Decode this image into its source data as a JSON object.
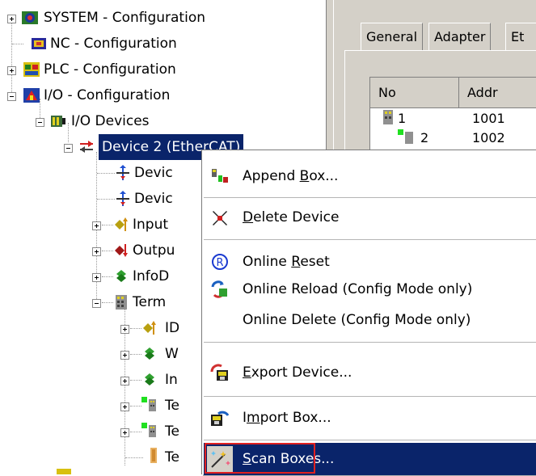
{
  "tree": {
    "items": [
      {
        "label": "SYSTEM - Configuration"
      },
      {
        "label": "NC - Configuration"
      },
      {
        "label": "PLC - Configuration"
      },
      {
        "label": "I/O - Configuration"
      },
      {
        "label": "I/O Devices"
      },
      {
        "label": "Device 2 (EtherCAT)"
      },
      {
        "label": "Devic"
      },
      {
        "label": "Devic"
      },
      {
        "label": "Input"
      },
      {
        "label": "Outpu"
      },
      {
        "label": "InfoD"
      },
      {
        "label": "Term"
      },
      {
        "label": "ID"
      },
      {
        "label": "W"
      },
      {
        "label": "In"
      },
      {
        "label": "Te"
      },
      {
        "label": "Te"
      },
      {
        "label": "Te"
      }
    ]
  },
  "right_pane": {
    "tabs": [
      "General",
      "Adapter",
      "Et"
    ],
    "columns": [
      "No",
      "Addr"
    ],
    "rows": [
      {
        "no": "1",
        "addr": "1001"
      },
      {
        "no": "2",
        "addr": "1002"
      }
    ]
  },
  "context_menu": {
    "append_box": {
      "mnemonic_pre": "Append ",
      "mnemonic": "B",
      "rest": "ox..."
    },
    "delete_device": {
      "mnemonic_pre": "",
      "mnemonic": "D",
      "rest": "elete Device"
    },
    "online_reset": {
      "mnemonic_pre": "Online ",
      "mnemonic": "R",
      "rest": "eset"
    },
    "online_reload": {
      "label": "Online Reload (Config Mode only)"
    },
    "online_delete": {
      "label": "Online Delete (Config Mode only)"
    },
    "export_device": {
      "mnemonic_pre": "",
      "mnemonic": "E",
      "rest": "xport Device..."
    },
    "import_box": {
      "mnemonic_pre": "I",
      "mnemonic": "m",
      "rest": "port Box..."
    },
    "scan_boxes": {
      "mnemonic_pre": "",
      "mnemonic": "S",
      "rest": "can Boxes..."
    }
  },
  "colors": {
    "selection": "#0a246a",
    "highlight_box": "#e02020",
    "face": "#d4d0c8"
  }
}
